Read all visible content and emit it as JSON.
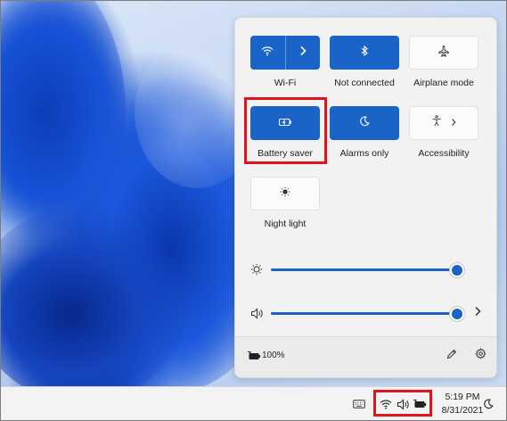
{
  "quick_settings": {
    "tiles": [
      {
        "id": "wifi",
        "label": "Wi-Fi",
        "state": "on",
        "icon": "wifi-icon",
        "has_chevron": true
      },
      {
        "id": "bluetooth",
        "label": "Not connected",
        "state": "on",
        "icon": "bluetooth-icon"
      },
      {
        "id": "airplane",
        "label": "Airplane mode",
        "state": "off",
        "icon": "airplane-icon"
      },
      {
        "id": "battery_saver",
        "label": "Battery saver",
        "state": "on",
        "icon": "battery-saver-icon"
      },
      {
        "id": "focus_assist",
        "label": "Alarms only",
        "state": "on",
        "icon": "moon-icon"
      },
      {
        "id": "accessibility",
        "label": "Accessibility",
        "state": "off",
        "icon": "accessibility-icon",
        "has_chevron": true
      },
      {
        "id": "night_light",
        "label": "Night light",
        "state": "off",
        "icon": "brightness-icon"
      }
    ],
    "brightness": {
      "icon": "sun-icon",
      "level_percent": 100
    },
    "volume": {
      "icon": "speaker-icon",
      "level_percent": 100,
      "has_chevron": true
    },
    "footer": {
      "battery_icon": "battery-charging-icon",
      "battery_text": "100%",
      "edit_icon": "pencil-icon",
      "settings_icon": "gear-icon"
    }
  },
  "taskbar": {
    "tray": [
      "keyboard-icon",
      "wifi-icon",
      "speaker-icon",
      "battery-charging-icon"
    ],
    "clock": {
      "time": "5:19 PM",
      "date": "8/31/2021"
    },
    "notification_icon": "moon-icon"
  },
  "colors": {
    "accent": "#1a64c8",
    "highlight": "#e0141c",
    "panel_bg": "#f2f2f2"
  }
}
